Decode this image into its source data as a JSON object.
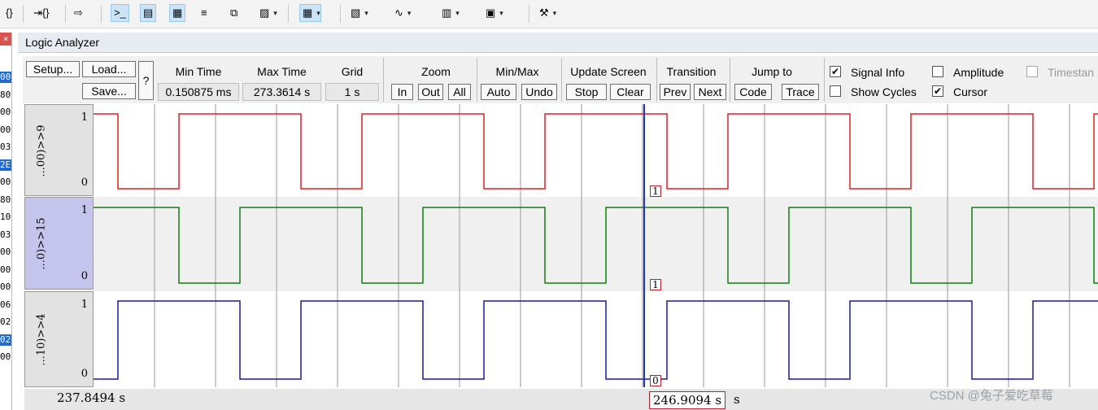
{
  "window": {
    "title": "Logic Analyzer"
  },
  "toolbar": {
    "items": [
      {
        "name": "braces-open-icon",
        "glyph": "{}"
      },
      {
        "name": "braces-step-icon",
        "glyph": "⇥{}"
      },
      {
        "name": "arrow-right-icon",
        "glyph": "⇨"
      },
      {
        "name": "command-window-icon",
        "glyph": ">_"
      },
      {
        "name": "disassembly-window-icon",
        "glyph": "▤"
      },
      {
        "name": "symbols-window-icon",
        "glyph": "▦"
      },
      {
        "name": "registers-window-icon",
        "glyph": "≡"
      },
      {
        "name": "call-stack-window-icon",
        "glyph": "⧉"
      },
      {
        "name": "watch-window-icon",
        "glyph": "▨"
      },
      {
        "name": "memory-window-icon",
        "glyph": "▦"
      },
      {
        "name": "serial-window-icon",
        "glyph": "▧"
      },
      {
        "name": "analysis-window-icon",
        "glyph": "∿"
      },
      {
        "name": "trace-window-icon",
        "glyph": "▥"
      },
      {
        "name": "system-viewer-icon",
        "glyph": "▣"
      },
      {
        "name": "tools-icon",
        "glyph": "⚒"
      }
    ]
  },
  "left_strip": {
    "close_glyph": "×",
    "rows": [
      "00",
      "80",
      "00",
      "00",
      "03",
      "2E",
      "00",
      "80",
      "10",
      "03",
      "00",
      "00",
      "00",
      "06",
      "02",
      "02",
      "00"
    ]
  },
  "controls": {
    "setup": "Setup...",
    "load": "Load...",
    "save": "Save...",
    "help": "?",
    "min_time_label": "Min Time",
    "min_time": "0.150875 ms",
    "max_time_label": "Max Time",
    "max_time": "273.3614 s",
    "grid_label": "Grid",
    "grid": "1 s",
    "zoom_label": "Zoom",
    "zoom_in": "In",
    "zoom_out": "Out",
    "zoom_all": "All",
    "minmax_label": "Min/Max",
    "auto": "Auto",
    "undo": "Undo",
    "update_label": "Update Screen",
    "stop": "Stop",
    "clear": "Clear",
    "transition_label": "Transition",
    "prev": "Prev",
    "next": "Next",
    "jump_label": "Jump to",
    "code": "Code",
    "trace": "Trace",
    "signal_info": "Signal Info",
    "show_cycles": "Show Cycles",
    "amplitude": "Amplitude",
    "cursor": "Cursor",
    "timestamp": "Timestan",
    "checks": {
      "signal_info": true,
      "show_cycles": false,
      "amplitude": false,
      "cursor": true,
      "timestamp": false
    }
  },
  "signals": [
    {
      "name": "...00)>>9",
      "high": "1",
      "low": "0",
      "cursor_value": "1",
      "color": "#e02020"
    },
    {
      "name": "...0)>>15",
      "high": "1",
      "low": "0",
      "cursor_value": "1",
      "color": "#108010"
    },
    {
      "name": "...10)>>4",
      "high": "1",
      "low": "0",
      "cursor_value": "0",
      "color": "#1a1a9a"
    }
  ],
  "status": {
    "left_time": "237.8494  s",
    "cursor_time": "246.9094  s",
    "unit": "s"
  },
  "watermark": "CSDN @兔子爱吃草莓"
}
